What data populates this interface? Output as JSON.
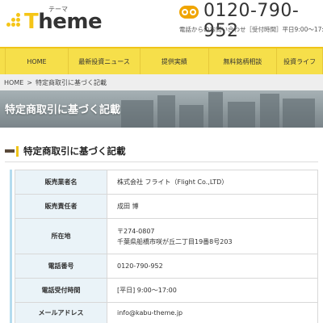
{
  "header": {
    "logo_tagline": "テーマ",
    "logo_text_first": "T",
    "logo_text_rest": "heme",
    "phone_number": "0120-790-952",
    "phone_note": "電話からのお問い合わせ［受付時間］平日9:00～17:00"
  },
  "nav": {
    "items": [
      {
        "label": "HOME"
      },
      {
        "label": "最新投資ニュース"
      },
      {
        "label": "提供実績"
      },
      {
        "label": "無料銘柄相談"
      },
      {
        "label": "投資ライフ"
      }
    ]
  },
  "breadcrumb": {
    "home": "HOME",
    "separator": ">",
    "current": "特定商取引に基づく記載"
  },
  "banner": {
    "title": "特定商取引に基づく記載"
  },
  "section": {
    "heading": "特定商取引に基づく記載"
  },
  "table": {
    "rows": [
      {
        "label": "販売業者名",
        "value": "株式会社 フライト（Flight Co.,LTD）"
      },
      {
        "label": "販売責任者",
        "value": "成田 博"
      },
      {
        "label": "所在地",
        "value": "〒274-0807",
        "value2": "千葉県船橋市咲が丘二丁目19番8号203"
      },
      {
        "label": "電話番号",
        "value": "0120-790-952"
      },
      {
        "label": "電話受付時間",
        "value": "[平日] 9:00～17:00"
      },
      {
        "label": "メールアドレス",
        "value": "info@kabu-theme.jp"
      }
    ]
  },
  "colors": {
    "nav_background": "#f6df4a",
    "accent_yellow": "#f5c518",
    "phone_icon": "#f0a500",
    "table_header_bg": "#eaf3f8"
  }
}
